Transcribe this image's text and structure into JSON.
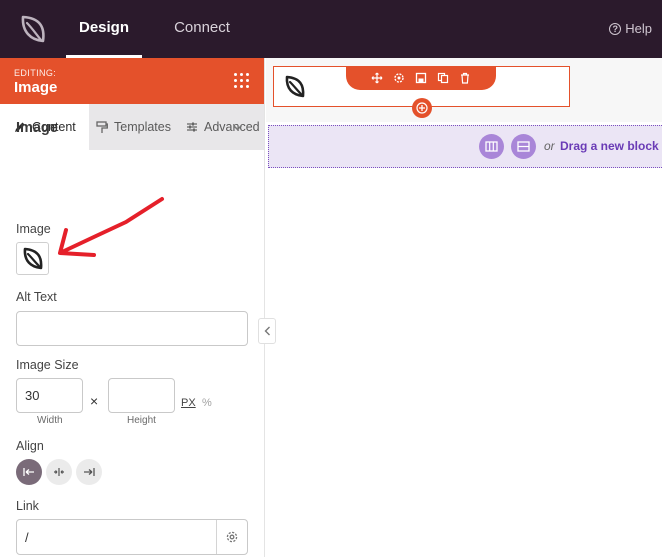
{
  "topbar": {
    "tabs": [
      {
        "label": "Design",
        "active": true
      },
      {
        "label": "Connect",
        "active": false
      }
    ],
    "help_label": "Help"
  },
  "panel": {
    "editing_label": "EDITING:",
    "editing_title": "Image",
    "subtabs": [
      {
        "label": "Content",
        "icon": "pencil-icon",
        "active": true
      },
      {
        "label": "Templates",
        "icon": "paint-roller-icon",
        "active": false
      },
      {
        "label": "Advanced",
        "icon": "sliders-icon",
        "active": false
      }
    ],
    "section_title": "Image",
    "fields": {
      "image_label": "Image",
      "alt_text_label": "Alt Text",
      "alt_text_value": "",
      "image_size_label": "Image Size",
      "width_value": "30",
      "width_caption": "Width",
      "height_value": "",
      "height_caption": "Height",
      "times_symbol": "×",
      "unit_px": "PX",
      "unit_pct": "%",
      "align_label": "Align",
      "align_options": [
        "left",
        "center",
        "right"
      ],
      "align_selected": "left",
      "link_label": "Link",
      "link_value": "/"
    }
  },
  "canvas": {
    "drop_or": "or",
    "drop_text": "Drag a new block here"
  },
  "colors": {
    "topbar_bg": "#2b1a2c",
    "accent": "#e4512b",
    "drop_zone": "#7b4fc0"
  }
}
